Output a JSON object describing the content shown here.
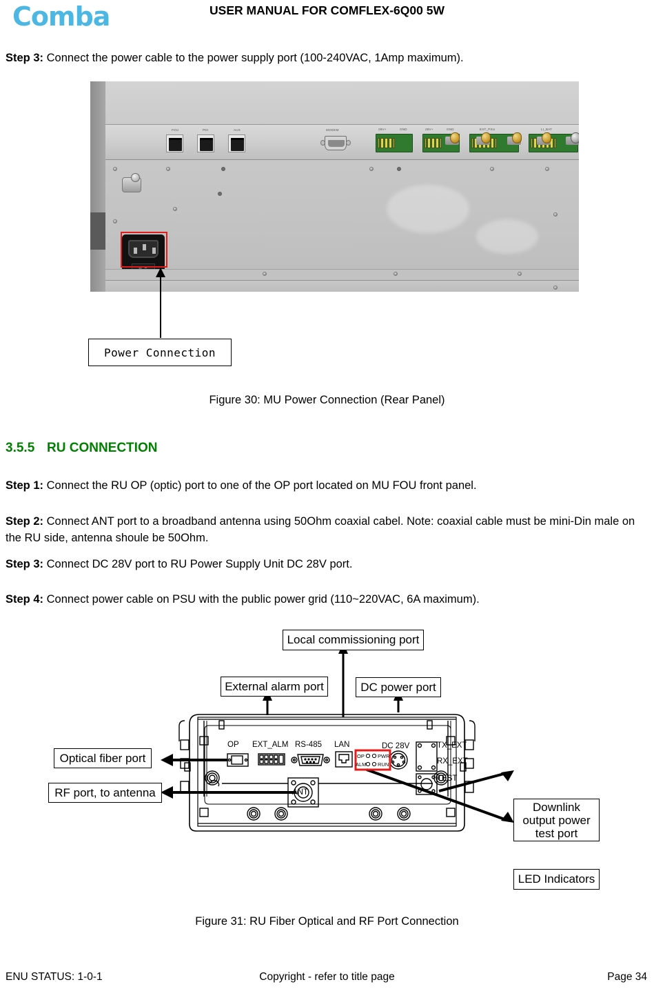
{
  "header": {
    "logo_text": "Comba",
    "logo_color": "#4cb7e2",
    "title": "USER MANUAL FOR COMFLEX-6Q00 5W"
  },
  "content": {
    "step3_top_label": "Step 3:",
    "step3_top_text": " Connect the power cable to the power supply port (100-240VAC, 1Amp maximum).",
    "figure30_caption": "Figure 30: MU Power Connection (Rear Panel)",
    "section": {
      "number": "3.5.5",
      "title": "RU CONNECTION",
      "color": "#008000"
    },
    "step1_label": "Step 1:",
    "step1_text": " Connect the RU OP (optic) port to one of the OP port located on MU FOU front panel.",
    "step2_label": "Step 2:",
    "step2_text": " Connect ANT port to a broadband antenna using 50Ohm coaxial cabel. Note: coaxial cable must be mini-Din male on the RU side, antenna shoule be 50Ohm.",
    "step3_label": "Step 3:",
    "step3_text": " Connect DC 28V port to RU Power Supply Unit DC 28V port.",
    "step4_label": "Step 4:",
    "step4_text": " Connect power cable on PSU with the public power grid (110~220VAC, 6A maximum).",
    "figure31_caption": "Figure 31:  RU Fiber Optical and RF Port Connection"
  },
  "figure30": {
    "callout_label": "Power Connection",
    "highlight_color": "#e21b1b",
    "panel_port_labels": [
      "FOU",
      "PDI",
      "AUX",
      "MODEM",
      "28V+",
      "GND",
      "28V+",
      "GND",
      "EXT_PSU",
      "LI_BAT"
    ]
  },
  "figure31": {
    "callouts": {
      "local_commissioning": "Local commissioning port",
      "external_alarm": "External alarm port",
      "dc_power": "DC power port",
      "optical_fiber": "Optical fiber port",
      "rf_port": "RF port, to antenna",
      "downlink_line1": "Downlink",
      "downlink_line2": "output power",
      "downlink_line3": "test port",
      "led_indicators": "LED Indicators"
    },
    "panel_labels": {
      "op": "OP",
      "ext_alm": "EXT_ALM",
      "rs485": "RS-485",
      "lan": "LAN",
      "dc28v": "DC 28V",
      "tx_ext": "TX_EXT",
      "rx_ext": "RX_EXT",
      "test": "TEST",
      "ant": "ANT"
    },
    "led_labels": {
      "op": "OP",
      "pwr": "PWR",
      "alm": "ALM",
      "run": "RUN"
    },
    "highlight_color": "#e21b1b"
  },
  "footer": {
    "status": "ENU STATUS: 1-0-1",
    "copyright": "Copyright - refer to title page",
    "page": "Page 34"
  }
}
